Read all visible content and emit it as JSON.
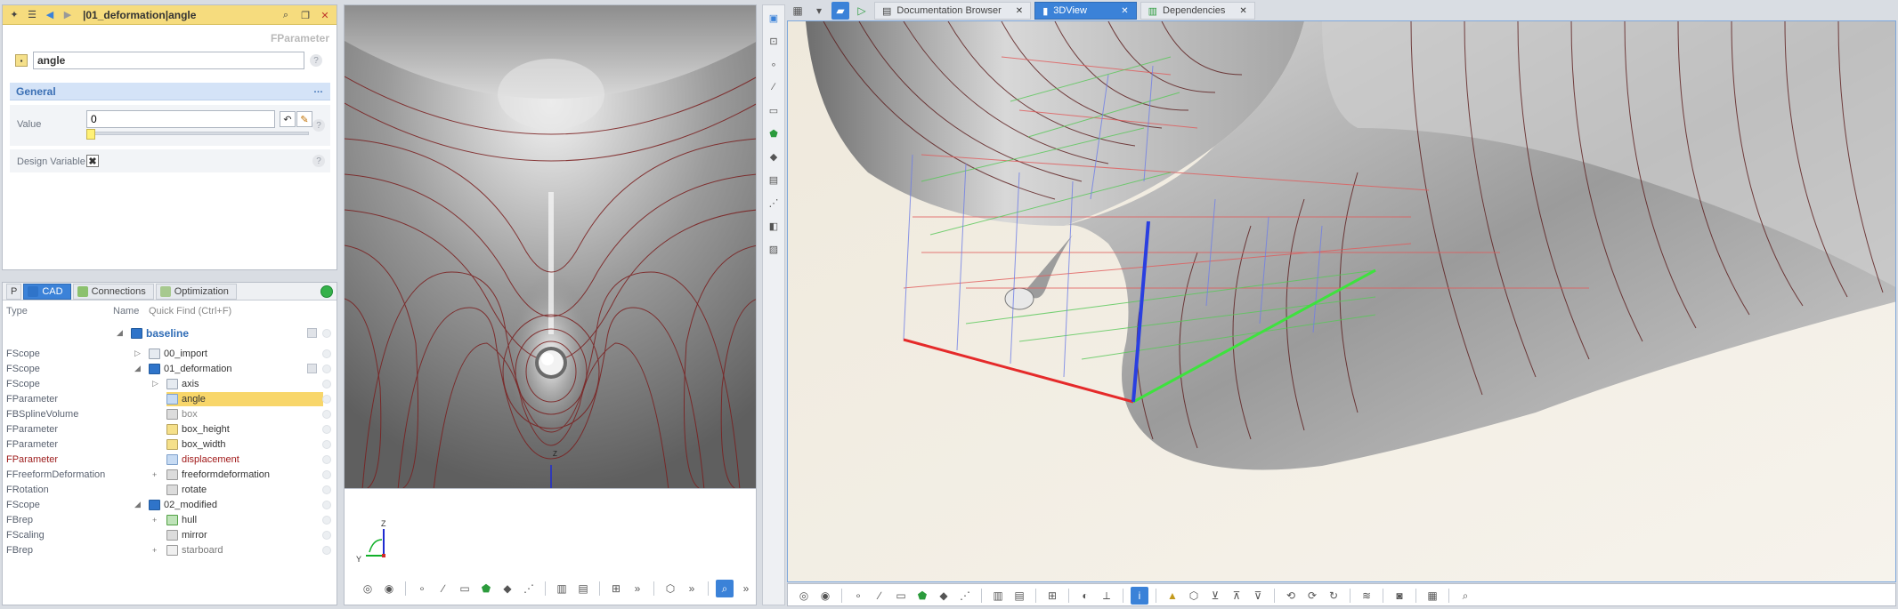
{
  "properties": {
    "title": "|01_deformation|angle",
    "type": "FParameter",
    "name": "angle",
    "section": "General",
    "value_label": "Value",
    "value": "0",
    "slider_fraction": 0,
    "design_variable_label": "Design Variable"
  },
  "tree": {
    "tabs": [
      {
        "label": "CAD"
      },
      {
        "label": "Connections"
      },
      {
        "label": "Optimization"
      }
    ],
    "columns": {
      "type": "Type",
      "name": "Name",
      "quickfind": "Quick Find (Ctrl+F)"
    },
    "rows": [
      {
        "type": "",
        "name": "baseline"
      },
      {
        "type": "FScope",
        "name": "00_import"
      },
      {
        "type": "FScope",
        "name": "01_deformation"
      },
      {
        "type": "FScope",
        "name": "axis"
      },
      {
        "type": "FParameter",
        "name": "angle"
      },
      {
        "type": "FBSplineVolume",
        "name": "box"
      },
      {
        "type": "FParameter",
        "name": "box_height"
      },
      {
        "type": "FParameter",
        "name": "box_width"
      },
      {
        "type": "FParameter",
        "name": "displacement"
      },
      {
        "type": "FFreeformDeformation",
        "name": "freeformdeformation"
      },
      {
        "type": "FRotation",
        "name": "rotate"
      },
      {
        "type": "FScope",
        "name": "02_modified"
      },
      {
        "type": "FBrep",
        "name": "hull"
      },
      {
        "type": "FScaling",
        "name": "mirror"
      },
      {
        "type": "FBrep",
        "name": "starboard"
      }
    ]
  },
  "front_view": {
    "axis_z": "Z",
    "axis_y": "Y"
  },
  "doc_tabs": [
    {
      "label": "Documentation Browser"
    },
    {
      "label": "3DView"
    },
    {
      "label": "Dependencies"
    }
  ],
  "icons": [
    "magnet-icon",
    "menu-icon",
    "back-icon",
    "forward-icon",
    "search-icon",
    "copy-icon",
    "close-icon",
    "help-icon",
    "reset-icon",
    "edit-icon",
    "cube-icon",
    "camera-icon",
    "grid-icon",
    "info-icon",
    "lock-icon"
  ]
}
